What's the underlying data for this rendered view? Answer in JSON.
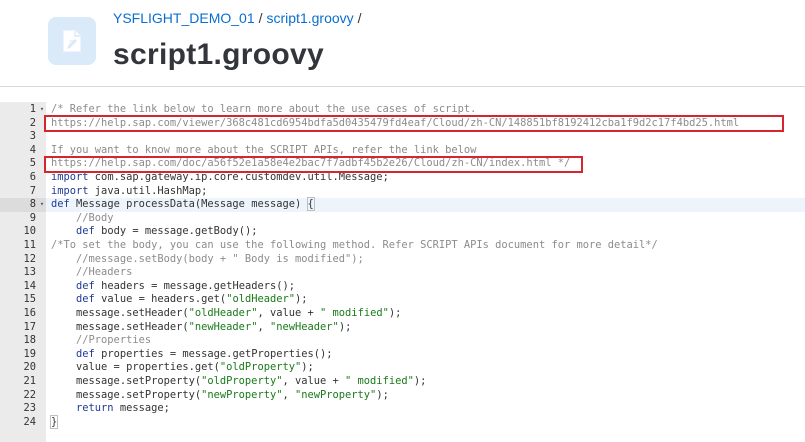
{
  "header": {
    "breadcrumb": {
      "project": "YSFLIGHT_DEMO_01",
      "separator": "/",
      "file": "script1.groovy",
      "trailing": "/"
    },
    "title": "script1.groovy",
    "icon": "script-file-icon"
  },
  "editor": {
    "language": "groovy",
    "active_line": 8,
    "lines": [
      {
        "n": "1",
        "fold": "▾",
        "parts": [
          {
            "t": "/* Refer the link below to learn more about the use cases of script.",
            "c": "c"
          }
        ]
      },
      {
        "n": "2",
        "fold": "",
        "parts": [
          {
            "t": "https://help.sap.com/viewer/368c481cd6954bdfa5d0435479fd4eaf/Cloud/zh-CN/148851bf8192412cba1f9d2c17f4bd25.html",
            "c": "c"
          }
        ]
      },
      {
        "n": "3",
        "fold": "",
        "parts": []
      },
      {
        "n": "4",
        "fold": "",
        "parts": [
          {
            "t": "If you want to know more about the SCRIPT APIs, refer the link below",
            "c": "c"
          }
        ]
      },
      {
        "n": "5",
        "fold": "",
        "parts": [
          {
            "t": "https://help.sap.com/doc/a56f52e1a58e4e2bac7f7adbf45b2e26/Cloud/zh-CN/index.html",
            "c": "c"
          },
          {
            "t": " */",
            "c": "c"
          }
        ]
      },
      {
        "n": "6",
        "fold": "",
        "parts": [
          {
            "t": "import",
            "c": "k"
          },
          {
            "t": " com.sap.gateway.ip.core.customdev.util.Message;",
            "c": ""
          }
        ]
      },
      {
        "n": "7",
        "fold": "",
        "parts": [
          {
            "t": "import",
            "c": "k"
          },
          {
            "t": " java.util.HashMap;",
            "c": ""
          }
        ]
      },
      {
        "n": "8",
        "fold": "▾",
        "parts": [
          {
            "t": "def",
            "c": "k"
          },
          {
            "t": " Message processData(Message message) ",
            "c": ""
          },
          {
            "t": "{",
            "c": "brace"
          }
        ]
      },
      {
        "n": "9",
        "fold": "",
        "parts": [
          {
            "t": "    //Body",
            "c": "c"
          }
        ]
      },
      {
        "n": "10",
        "fold": "",
        "parts": [
          {
            "t": "    ",
            "c": ""
          },
          {
            "t": "def",
            "c": "k"
          },
          {
            "t": " body = message.getBody();",
            "c": ""
          }
        ]
      },
      {
        "n": "11",
        "fold": "",
        "parts": [
          {
            "t": "/*To set the body, you can use the following method. Refer SCRIPT APIs document for more detail*/",
            "c": "c"
          }
        ]
      },
      {
        "n": "12",
        "fold": "",
        "parts": [
          {
            "t": "    //message.setBody(body + \" Body is modified\");",
            "c": "c"
          }
        ]
      },
      {
        "n": "13",
        "fold": "",
        "parts": [
          {
            "t": "    //Headers",
            "c": "c"
          }
        ]
      },
      {
        "n": "14",
        "fold": "",
        "parts": [
          {
            "t": "    ",
            "c": ""
          },
          {
            "t": "def",
            "c": "k"
          },
          {
            "t": " headers = message.getHeaders();",
            "c": ""
          }
        ]
      },
      {
        "n": "15",
        "fold": "",
        "parts": [
          {
            "t": "    ",
            "c": ""
          },
          {
            "t": "def",
            "c": "k"
          },
          {
            "t": " value = headers.get(",
            "c": ""
          },
          {
            "t": "\"oldHeader\"",
            "c": "s"
          },
          {
            "t": ");",
            "c": ""
          }
        ]
      },
      {
        "n": "16",
        "fold": "",
        "parts": [
          {
            "t": "    message.setHeader(",
            "c": ""
          },
          {
            "t": "\"oldHeader\"",
            "c": "s"
          },
          {
            "t": ", value + ",
            "c": ""
          },
          {
            "t": "\" modified\"",
            "c": "s"
          },
          {
            "t": ");",
            "c": ""
          }
        ]
      },
      {
        "n": "17",
        "fold": "",
        "parts": [
          {
            "t": "    message.setHeader(",
            "c": ""
          },
          {
            "t": "\"newHeader\"",
            "c": "s"
          },
          {
            "t": ", ",
            "c": ""
          },
          {
            "t": "\"newHeader\"",
            "c": "s"
          },
          {
            "t": ");",
            "c": ""
          }
        ]
      },
      {
        "n": "18",
        "fold": "",
        "parts": [
          {
            "t": "    //Properties",
            "c": "c"
          }
        ]
      },
      {
        "n": "19",
        "fold": "",
        "parts": [
          {
            "t": "    ",
            "c": ""
          },
          {
            "t": "def",
            "c": "k"
          },
          {
            "t": " properties = message.getProperties();",
            "c": ""
          }
        ]
      },
      {
        "n": "20",
        "fold": "",
        "parts": [
          {
            "t": "    value = properties.get(",
            "c": ""
          },
          {
            "t": "\"oldProperty\"",
            "c": "s"
          },
          {
            "t": ");",
            "c": ""
          }
        ]
      },
      {
        "n": "21",
        "fold": "",
        "parts": [
          {
            "t": "    message.setProperty(",
            "c": ""
          },
          {
            "t": "\"oldProperty\"",
            "c": "s"
          },
          {
            "t": ", value + ",
            "c": ""
          },
          {
            "t": "\" modified\"",
            "c": "s"
          },
          {
            "t": ");",
            "c": ""
          }
        ]
      },
      {
        "n": "22",
        "fold": "",
        "parts": [
          {
            "t": "    message.setProperty(",
            "c": ""
          },
          {
            "t": "\"newProperty\"",
            "c": "s"
          },
          {
            "t": ", ",
            "c": ""
          },
          {
            "t": "\"newProperty\"",
            "c": "s"
          },
          {
            "t": ");",
            "c": ""
          }
        ]
      },
      {
        "n": "23",
        "fold": "",
        "parts": [
          {
            "t": "    ",
            "c": ""
          },
          {
            "t": "return",
            "c": "k"
          },
          {
            "t": " message;",
            "c": ""
          }
        ]
      },
      {
        "n": "24",
        "fold": "",
        "parts": [
          {
            "t": "}",
            "c": "brace"
          }
        ]
      }
    ]
  },
  "colors": {
    "link": "#0a6ed1",
    "title": "#32363a",
    "highlight_box": "#d6252f",
    "keyword": "#1f3a93",
    "string": "#1a7a1a",
    "comment": "#8c8c8c"
  }
}
